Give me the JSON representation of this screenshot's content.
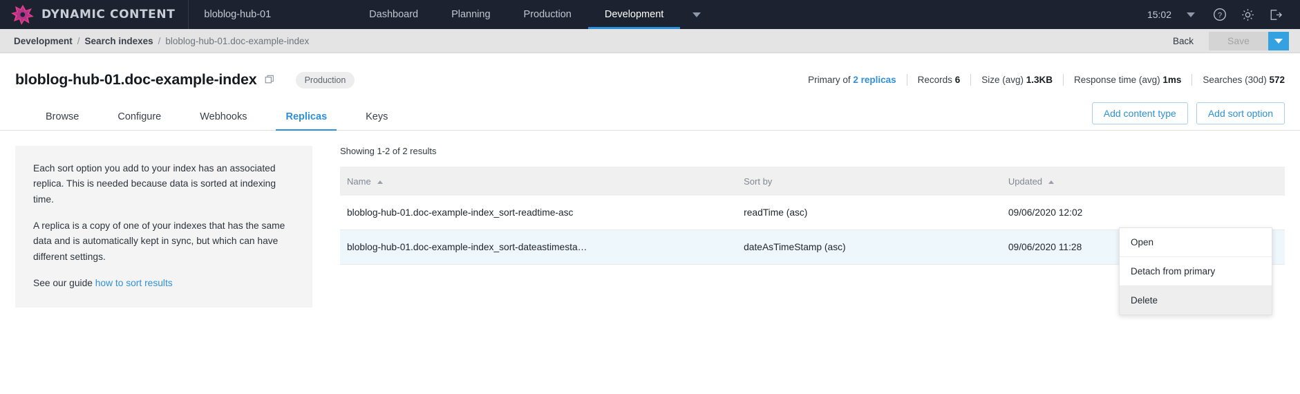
{
  "topbar": {
    "brand": "DYNAMIC CONTENT",
    "hub": "bloblog-hub-01",
    "nav": [
      {
        "label": "Dashboard",
        "active": false
      },
      {
        "label": "Planning",
        "active": false
      },
      {
        "label": "Production",
        "active": false
      },
      {
        "label": "Development",
        "active": true
      }
    ],
    "clock": "15:02",
    "icons": [
      "help-icon",
      "gear-icon",
      "logout-icon"
    ],
    "accent": "#2b90d9"
  },
  "breadcrumb": {
    "items": [
      "Development",
      "Search indexes",
      "bloblog-hub-01.doc-example-index"
    ],
    "separator": "/",
    "back_label": "Back",
    "save_label": "Save"
  },
  "page": {
    "title": "bloblog-hub-01.doc-example-index",
    "badge": "Production",
    "stats": [
      {
        "label": "Primary of",
        "value": "2 replicas",
        "link": true
      },
      {
        "label": "Records",
        "value": "6",
        "link": false
      },
      {
        "label": "Size (avg)",
        "value": "1.3KB",
        "link": false
      },
      {
        "label": "Response time (avg)",
        "value": "1ms",
        "link": false
      },
      {
        "label": "Searches (30d)",
        "value": "572",
        "link": false
      }
    ]
  },
  "tabs": [
    {
      "label": "Browse",
      "active": false
    },
    {
      "label": "Configure",
      "active": false
    },
    {
      "label": "Webhooks",
      "active": false
    },
    {
      "label": "Replicas",
      "active": true
    },
    {
      "label": "Keys",
      "active": false
    }
  ],
  "actions": {
    "add_content_type": "Add content type",
    "add_sort_option": "Add sort option"
  },
  "info_panel": {
    "paragraph1": "Each sort option you add to your index has an associated replica. This is needed because data is sorted at indexing time.",
    "paragraph2": "A replica is a copy of one of your indexes that has the same data and is automatically kept in sync, but which can have different settings.",
    "paragraph3_prefix": "See our guide ",
    "paragraph3_link": "how to sort results"
  },
  "results": {
    "showing": "Showing 1-2 of 2 results",
    "columns": [
      "Name",
      "Sort by",
      "Updated"
    ],
    "rows": [
      {
        "name": "bloblog-hub-01.doc-example-index_sort-readtime-asc",
        "sort_by": "readTime (asc)",
        "updated": "09/06/2020 12:02"
      },
      {
        "name": "bloblog-hub-01.doc-example-index_sort-dateastimesta…",
        "sort_by": "dateAsTimeStamp (asc)",
        "updated": "09/06/2020 11:28"
      }
    ]
  },
  "context_menu": {
    "items": [
      {
        "label": "Open",
        "hover": false
      },
      {
        "label": "Detach from primary",
        "hover": false
      },
      {
        "label": "Delete",
        "hover": true
      }
    ]
  }
}
